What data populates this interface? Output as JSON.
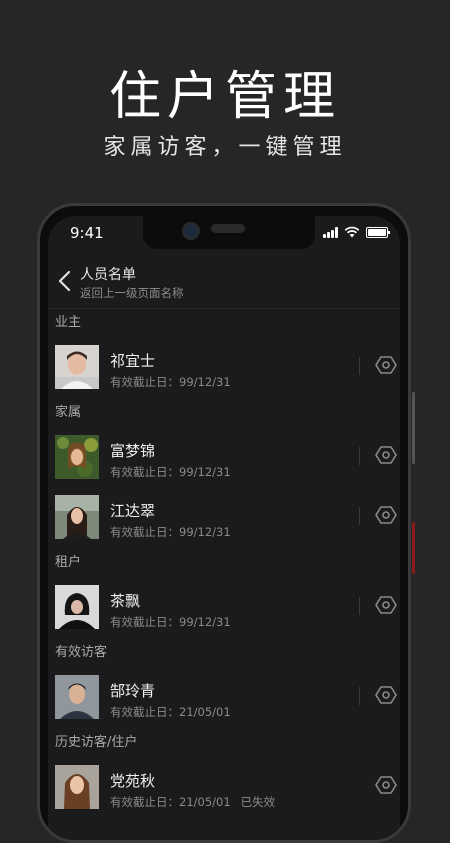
{
  "promo": {
    "title": "住户管理",
    "subtitle": "家属访客，一键管理"
  },
  "status_bar": {
    "time": "9:41"
  },
  "nav": {
    "title": "人员名单",
    "back_hint": "返回上一级页面名称"
  },
  "sections": [
    {
      "label": "业主"
    },
    {
      "label": "家属"
    },
    {
      "label": "租户"
    },
    {
      "label": "有效访客"
    },
    {
      "label": "历史访客/住户"
    }
  ],
  "people": [
    {
      "name": "祁宜士",
      "expiry": "有效截止日：99/12/31"
    },
    {
      "name": "富梦锦",
      "expiry": "有效截止日：99/12/31"
    },
    {
      "name": "江达翠",
      "expiry": "有效截止日：99/12/31"
    },
    {
      "name": "茶飘",
      "expiry": "有效截止日：99/12/31"
    },
    {
      "name": "郜玲青",
      "expiry": "有效截止日：21/05/01"
    },
    {
      "name": "党苑秋",
      "expiry": "有效截止日：21/05/01",
      "status": "已失效"
    }
  ],
  "icons": {
    "back": "chevron-left-icon",
    "settings": "hexagon-gear-icon",
    "wifi": "wifi-icon",
    "battery": "battery-icon",
    "signal": "signal-icon"
  },
  "colors": {
    "background": "#262626",
    "screen": "#1b1b1d",
    "text_primary": "#f0f0f0",
    "text_secondary": "#8a8a8a"
  }
}
